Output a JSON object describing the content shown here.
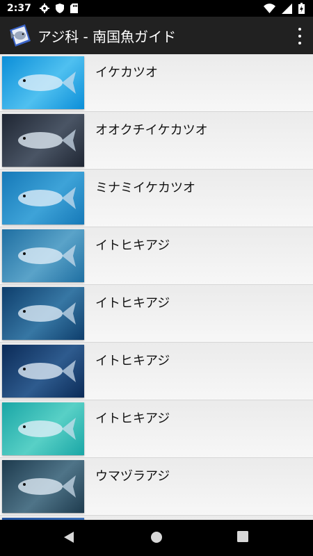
{
  "status_bar": {
    "time": "2:37",
    "left_icons": [
      "gear-icon",
      "shield-icon",
      "sd-card-icon"
    ],
    "right_icons": [
      "wifi-icon",
      "signal-icon",
      "battery-charging-icon"
    ]
  },
  "app_bar": {
    "title": "アジ科 - 南国魚ガイド",
    "background": "#212121"
  },
  "list": {
    "items": [
      {
        "label": "イケカツオ",
        "colors": [
          "#0b8ed8",
          "#4fc0f0"
        ]
      },
      {
        "label": "オオクチイケカツオ",
        "colors": [
          "#1f2633",
          "#4a5565"
        ]
      },
      {
        "label": "ミナミイケカツオ",
        "colors": [
          "#1679b8",
          "#3ea3d8"
        ]
      },
      {
        "label": "イトヒキアジ",
        "colors": [
          "#1f6fa2",
          "#5aa3c9"
        ]
      },
      {
        "label": "イトヒキアジ",
        "colors": [
          "#0e3e6c",
          "#3777a4"
        ]
      },
      {
        "label": "イトヒキアジ",
        "colors": [
          "#0b2b58",
          "#2e5b8e"
        ]
      },
      {
        "label": "イトヒキアジ",
        "colors": [
          "#1aa6a6",
          "#58d0c6"
        ]
      },
      {
        "label": "ウマヅラアジ",
        "colors": [
          "#1e3b4e",
          "#4f7488"
        ]
      }
    ]
  },
  "nav_bar": {
    "buttons": [
      "back-icon",
      "home-icon",
      "recents-icon"
    ]
  }
}
